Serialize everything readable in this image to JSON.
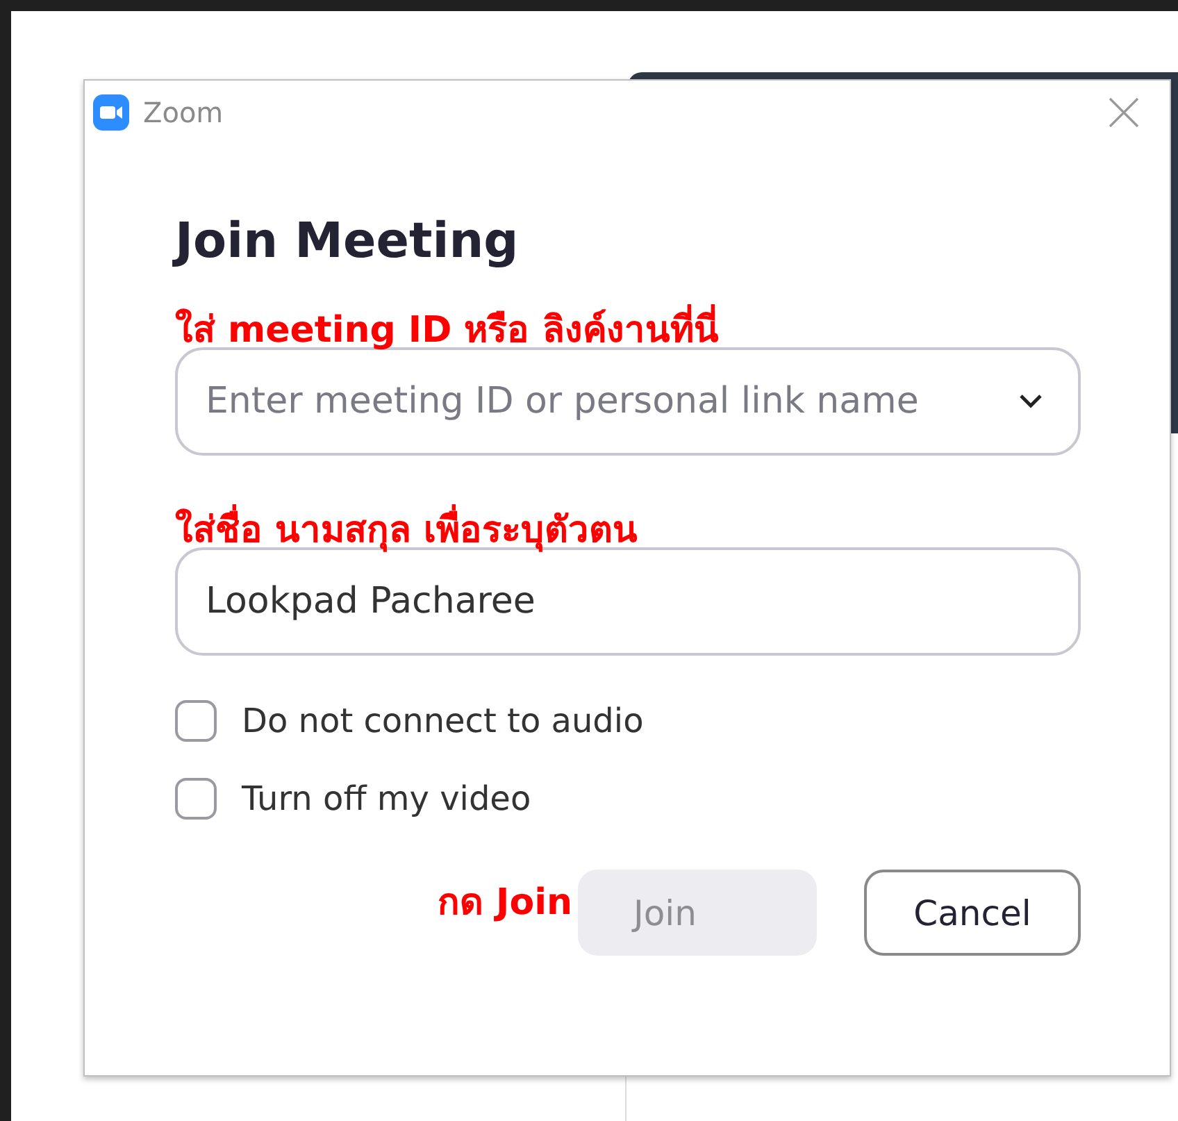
{
  "window": {
    "title": "Zoom"
  },
  "heading": "Join Meeting",
  "meeting_field": {
    "annotation": "ใส่ meeting ID หรือ ลิงค์งานที่นี่",
    "placeholder": "Enter meeting ID or personal link name"
  },
  "name_field": {
    "annotation": "ใส่ชื่อ นามสกุล เพื่อระบุตัวตน",
    "value": "Lookpad Pacharee"
  },
  "options": [
    {
      "label": "Do not connect to audio",
      "checked": false
    },
    {
      "label": "Turn off my video",
      "checked": false
    }
  ],
  "join_annotation": "กด Join",
  "buttons": [
    {
      "label": "Join",
      "kind": "primary",
      "disabled": true
    },
    {
      "label": "Cancel",
      "kind": "secondary",
      "disabled": false
    }
  ]
}
